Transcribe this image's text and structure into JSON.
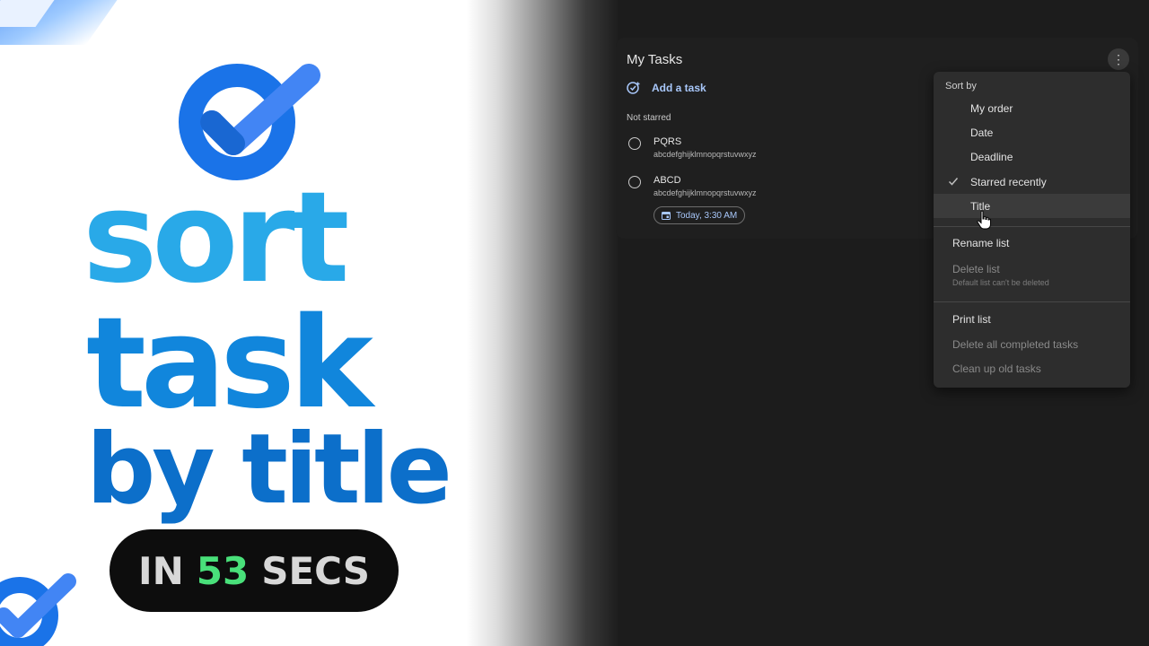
{
  "promo": {
    "word1": "sort",
    "word2": "task",
    "word3": "by title",
    "pill_prefix": "IN",
    "pill_number": "53",
    "pill_suffix": "SECS",
    "colors": {
      "word1": "#29a9e8",
      "word2": "#1186dc",
      "word3": "#0c6fca",
      "number": "#49e07a",
      "logo": "#1a73e8"
    },
    "logo_icon": "google-tasks-logo-icon"
  },
  "card": {
    "title": "My Tasks",
    "menu_icon": "more-vert-icon",
    "add_task_label": "Add a task",
    "add_task_icon": "add-task-icon",
    "section_label": "Not starred",
    "tasks": [
      {
        "title": "PQRS",
        "details": "abcdefghijklmnopqrstuvwxyz"
      },
      {
        "title": "ABCD",
        "details": "abcdefghijklmnopqrstuvwxyz",
        "date_chip": "Today, 3:30 AM",
        "chip_icon": "calendar-icon"
      }
    ]
  },
  "menu": {
    "sort_header": "Sort by",
    "sort_options": [
      "My order",
      "Date",
      "Deadline",
      "Starred recently",
      "Title"
    ],
    "selected": "Starred recently",
    "hovered": "Title",
    "rename": "Rename list",
    "delete": "Delete list",
    "delete_note": "Default list can't be deleted",
    "print": "Print list",
    "delete_completed": "Delete all completed tasks",
    "clean_up": "Clean up old tasks"
  }
}
